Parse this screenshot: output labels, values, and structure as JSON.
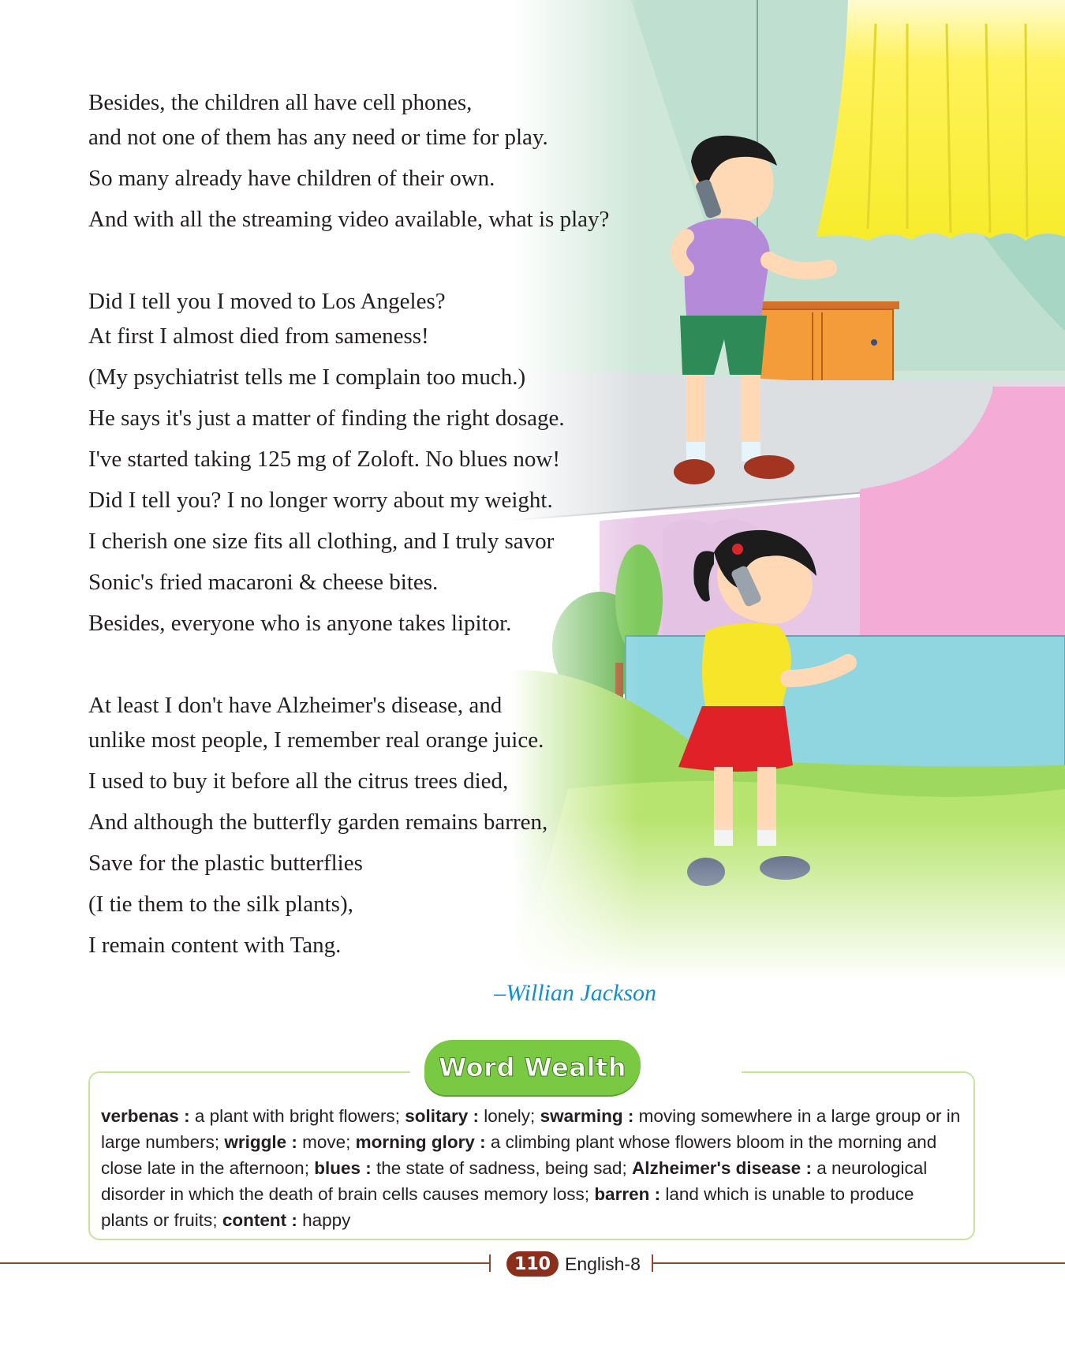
{
  "poem": {
    "stanzas": [
      [
        "Besides, the children all have cell phones,",
        "and not one of them has any need or time for play.",
        "So many already have children of their own.",
        "And with all the streaming video available, what is play?"
      ],
      [
        "Did I tell you I moved to Los Angeles?",
        "At first I almost died from sameness!",
        "(My psychiatrist tells me I complain too much.)",
        "He says it's just a matter of finding the right dosage.",
        "I've started taking 125 mg of Zoloft. No blues now!",
        "Did I tell you? I no longer worry about my weight.",
        "I cherish one size fits all clothing, and I truly savor",
        "Sonic's fried macaroni & cheese bites.",
        "Besides, everyone who is anyone takes lipitor."
      ],
      [
        "At least I don't have Alzheimer's disease, and",
        "unlike most people, I remember real orange juice.",
        "I used to buy it before all the citrus trees died,",
        "And although the butterfly garden remains barren,",
        "Save for the plastic butterflies",
        "(I tie them to the silk plants),",
        "I remain content with Tang."
      ]
    ],
    "author": "–Willian Jackson"
  },
  "word_wealth": {
    "title": "Word Wealth",
    "entries": [
      {
        "term": "verbenas",
        "definition": "a plant with bright flowers"
      },
      {
        "term": "solitary",
        "definition": "lonely"
      },
      {
        "term": "swarming",
        "definition": "moving somewhere in a large group or in large numbers"
      },
      {
        "term": "wriggle",
        "definition": "move"
      },
      {
        "term": "morning glory",
        "definition": "a climbing plant whose flowers bloom in the morning and close late in the afternoon"
      },
      {
        "term": "blues",
        "definition": "the state of sadness, being sad"
      },
      {
        "term": "Alzheimer's disease",
        "definition": "a neurological disorder in which the death of brain cells causes memory loss"
      },
      {
        "term": "barren",
        "definition": "land which is unable to produce plants or fruits"
      },
      {
        "term": "content",
        "definition": "happy"
      }
    ]
  },
  "footer": {
    "page_number": "110",
    "book": "English-8"
  },
  "colors": {
    "author": "#0f8fd3",
    "badge": "#7ac943",
    "page_badge": "#8b2f1c",
    "rule": "#8b4a2b"
  }
}
